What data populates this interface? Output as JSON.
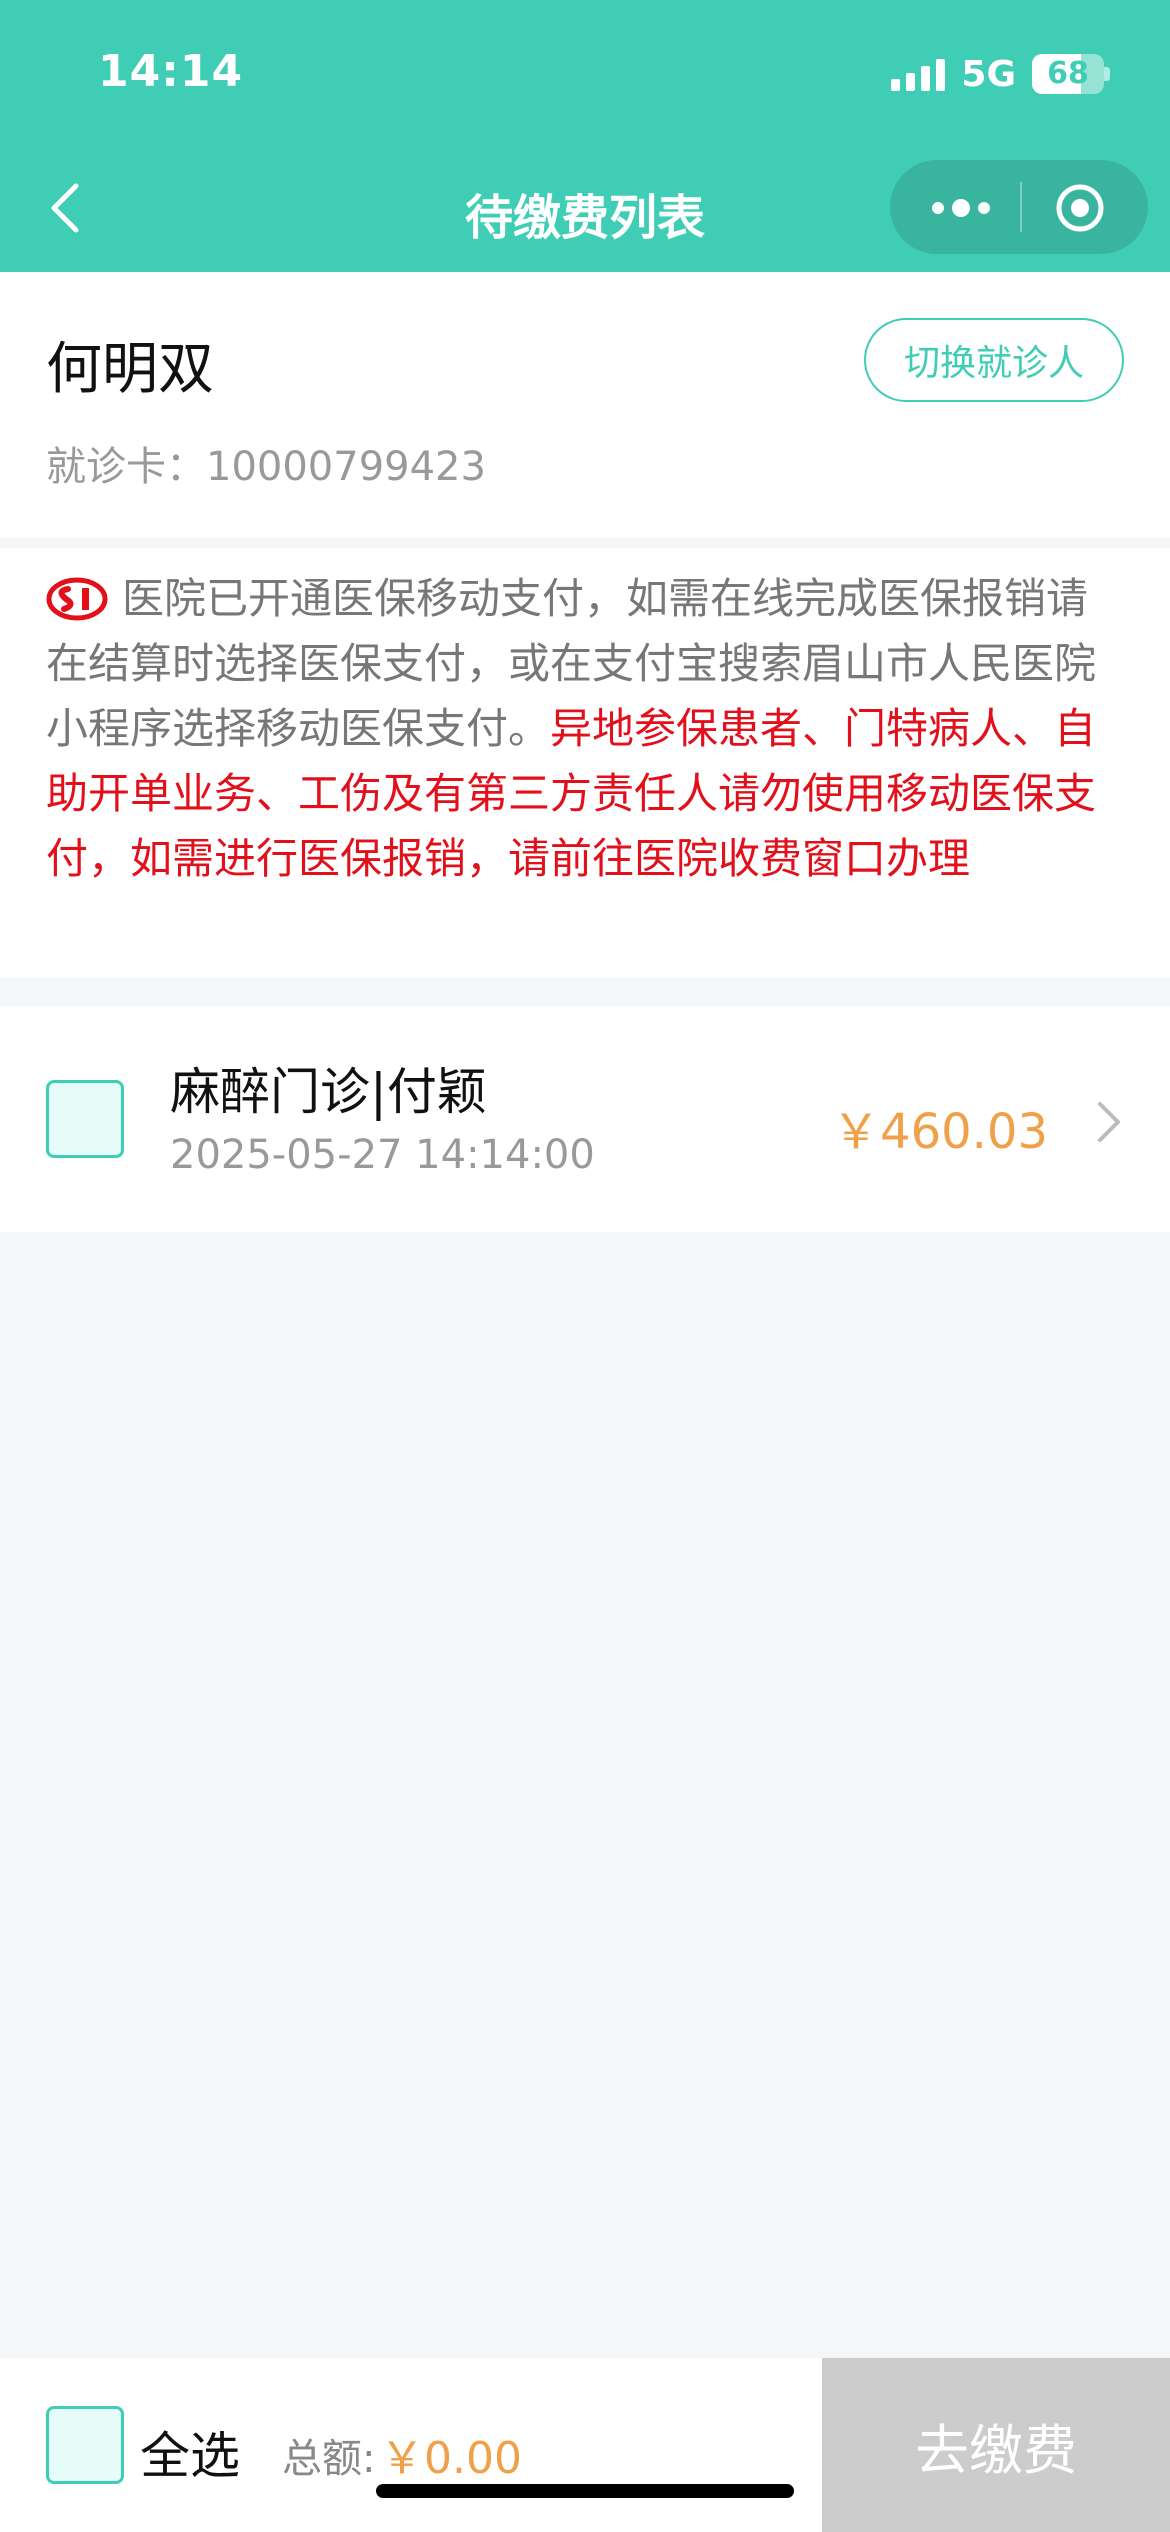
{
  "status_bar": {
    "time": "14:14",
    "network": "5G",
    "battery": "68"
  },
  "nav": {
    "title": "待缴费列表"
  },
  "patient": {
    "name": "何明双",
    "card_label": "就诊卡：",
    "card_number": "10000799423",
    "switch_label": "切换就诊人"
  },
  "notice": {
    "normal": "医院已开通医保移动支付，如需在线完成医保报销请在结算时选择医保支付，或在支付宝搜索眉山市人民医院小程序选择移动医保支付。",
    "warning": "异地参保患者、门特病人、自助开单业务、工伤及有第三方责任人请勿使用移动医保支付，如需进行医保报销，请前往医院收费窗口办理"
  },
  "bill": {
    "title": "麻醉门诊|付颖",
    "time": "2025-05-27 14:14:00",
    "amount": "￥460.03"
  },
  "bottom": {
    "select_all": "全选",
    "total_label": "总额:",
    "total_amount": "￥0.00",
    "pay_label": "去缴费"
  },
  "colors": {
    "primary": "#40cdb5",
    "warning": "#e2101b",
    "amount": "#f0a048",
    "disabled": "#cccccc"
  }
}
